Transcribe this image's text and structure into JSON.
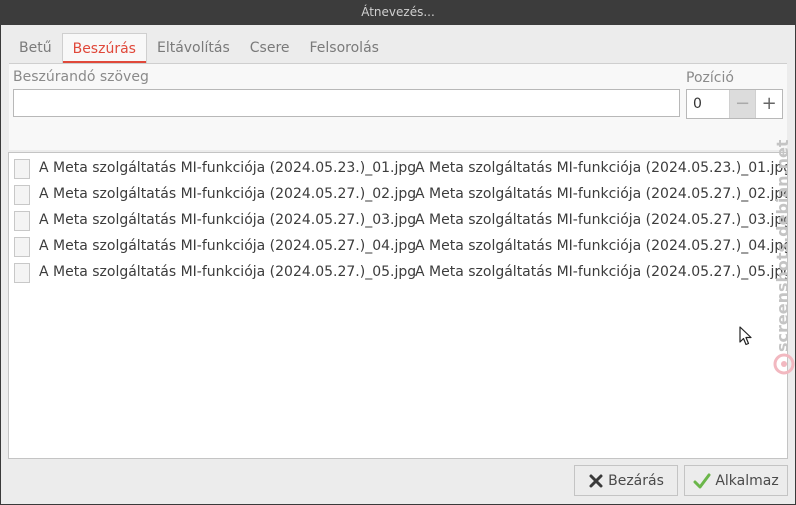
{
  "window": {
    "title": "Átnevezés..."
  },
  "tabs": [
    {
      "label": "Betű",
      "active": false
    },
    {
      "label": "Beszúrás",
      "active": true
    },
    {
      "label": "Eltávolítás",
      "active": false
    },
    {
      "label": "Csere",
      "active": false
    },
    {
      "label": "Felsorolás",
      "active": false
    }
  ],
  "insert": {
    "text_label": "Beszúrandó szöveg",
    "text_value": "",
    "position_label": "Pozíció",
    "position_value": "0",
    "minus": "−",
    "plus": "+"
  },
  "files": [
    {
      "old": "A Meta szolgáltatás MI-funkciója (2024.05.23.)_01.jpg",
      "new": "A Meta szolgáltatás MI-funkciója (2024.05.23.)_01.jpg"
    },
    {
      "old": "A Meta szolgáltatás MI-funkciója (2024.05.27.)_02.jpg",
      "new": "A Meta szolgáltatás MI-funkciója (2024.05.27.)_02.jpg"
    },
    {
      "old": "A Meta szolgáltatás MI-funkciója (2024.05.27.)_03.jpg",
      "new": "A Meta szolgáltatás MI-funkciója (2024.05.27.)_03.jpg"
    },
    {
      "old": "A Meta szolgáltatás MI-funkciója (2024.05.27.)_04.jpg",
      "new": "A Meta szolgáltatás MI-funkciója (2024.05.27.)_04.jpg"
    },
    {
      "old": "A Meta szolgáltatás MI-funkciója (2024.05.27.)_05.jpg",
      "new": "A Meta szolgáltatás MI-funkciója (2024.05.27.)_05.jpg"
    }
  ],
  "buttons": {
    "close": "Bezárás",
    "apply": "Alkalmaz"
  },
  "watermark": "screenshots.debian.net",
  "colors": {
    "accent": "#e0483a",
    "apply_check": "#6bb64a"
  }
}
